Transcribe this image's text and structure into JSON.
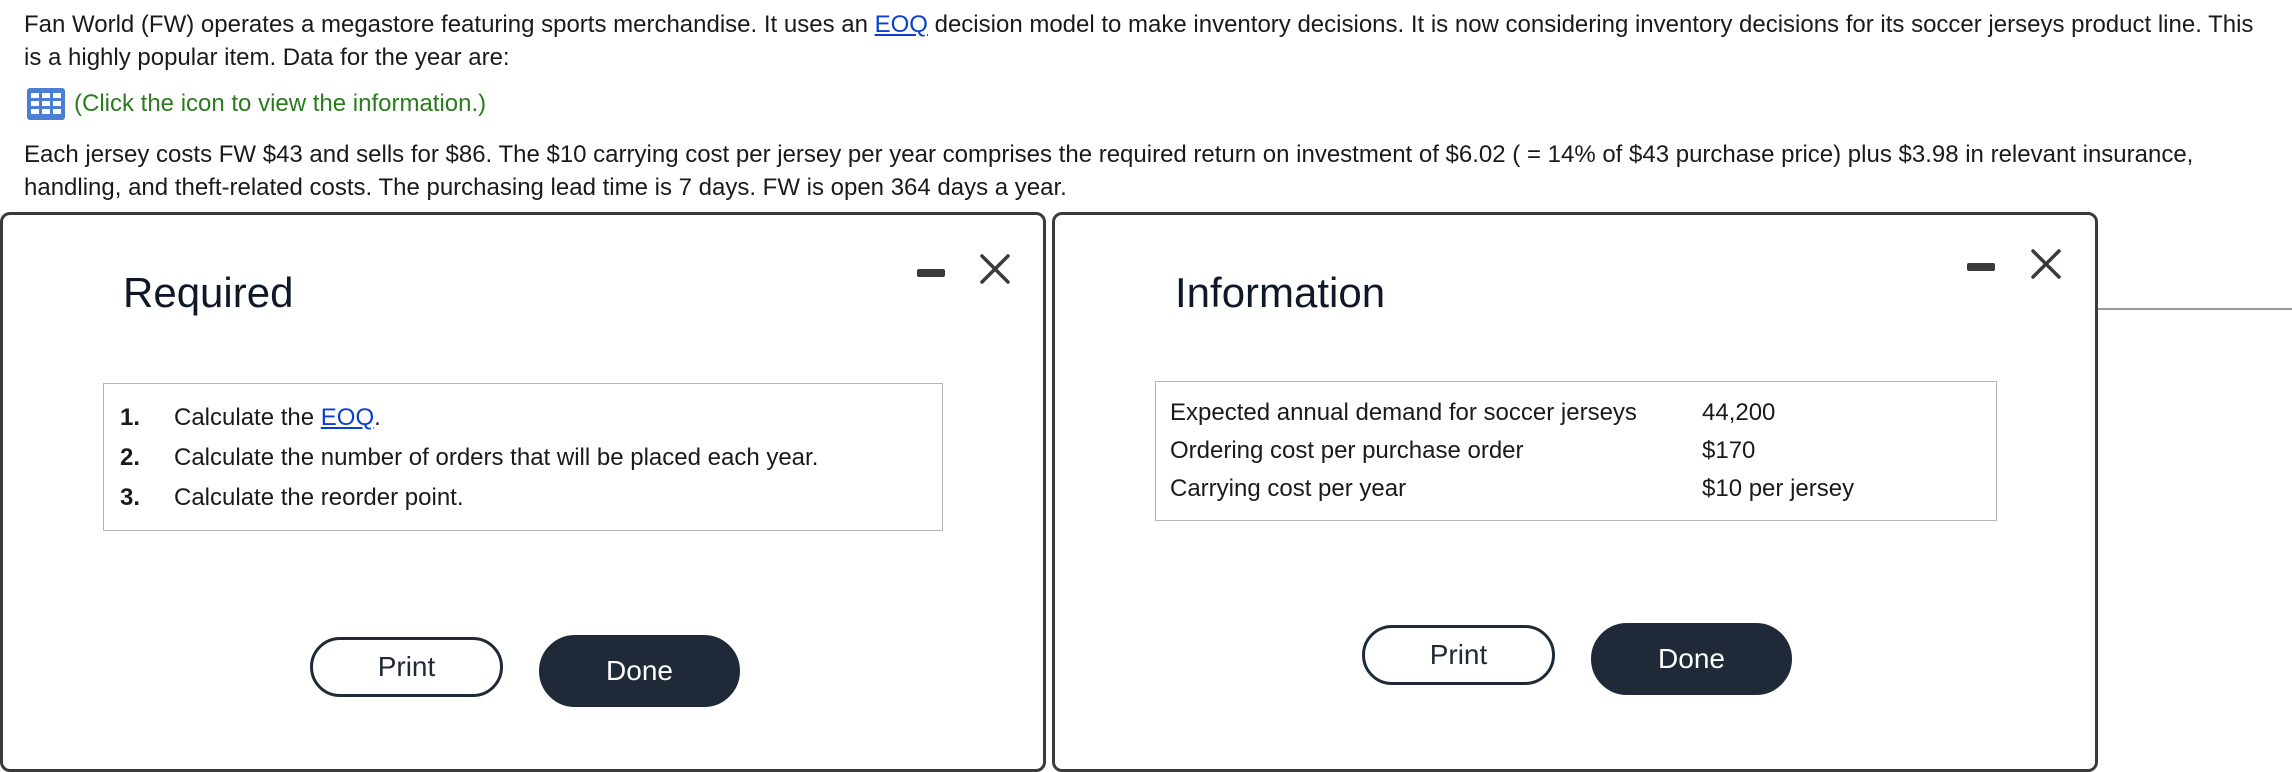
{
  "intro": {
    "before_link": "Fan World (FW) operates a megastore featuring sports merchandise. It uses an ",
    "link": "EOQ",
    "after_link": " decision model to make inventory decisions. It is now considering inventory decisions for its soccer jerseys product line. This is a highly popular item. Data for the year are:"
  },
  "info_link": "(Click the icon to view the information.)",
  "facts": "Each jersey costs FW $43 and sells for $86. The $10 carrying cost per jersey per year comprises the required return on investment of $6.02 ( = 14% of $43 purchase price) plus $3.98 in relevant insurance, handling, and theft-related costs. The purchasing lead time is 7 days. FW is open 364 days a year.",
  "required": {
    "title": "Required",
    "items": [
      {
        "num": "1.",
        "before": "Calculate the ",
        "link": "EOQ",
        "after": "."
      },
      {
        "num": "2.",
        "text": "Calculate the number of orders that will be placed each year."
      },
      {
        "num": "3.",
        "text": "Calculate the reorder point."
      }
    ],
    "print_label": "Print",
    "done_label": "Done"
  },
  "information": {
    "title": "Information",
    "rows": [
      {
        "label": "Expected annual demand for soccer jerseys",
        "value": "44,200"
      },
      {
        "label": "Ordering cost per purchase order",
        "value": "$170"
      },
      {
        "label": "Carrying cost per year",
        "value": "$10 per jersey"
      }
    ],
    "print_label": "Print",
    "done_label": "Done"
  },
  "icons": {
    "info": "table-grid-icon",
    "minimize": "minimize-icon",
    "close": "close-icon"
  },
  "colors": {
    "link": "#0b3fd1",
    "info_link": "#2a7a1e",
    "done_button": "#1f2937"
  }
}
